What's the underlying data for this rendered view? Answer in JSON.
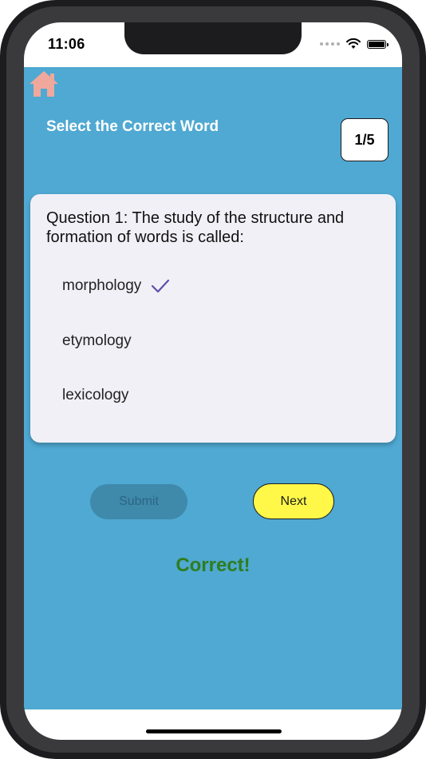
{
  "status_bar": {
    "time": "11:06",
    "icons": [
      "cellular-dots-icon",
      "wifi-icon",
      "battery-icon"
    ]
  },
  "header": {
    "home_icon": "house-icon",
    "title": "Select the Correct Word",
    "counter": "1/5"
  },
  "question": {
    "text": "Question 1: The study of the structure and formation of words is called:",
    "options": [
      {
        "label": "morphology",
        "selected": true
      },
      {
        "label": "etymology",
        "selected": false
      },
      {
        "label": "lexicology",
        "selected": false
      }
    ]
  },
  "actions": {
    "submit_label": "Submit",
    "next_label": "Next"
  },
  "feedback": {
    "text": "Correct!"
  },
  "colors": {
    "background": "#4fa9d2",
    "card": "#f2f0f7",
    "home_icon": "#f0a89c",
    "next_button": "#fff849",
    "submit_button": "#3f89ab",
    "correct_text": "#2e7d1e",
    "checkmark": "#5b4fa8"
  }
}
